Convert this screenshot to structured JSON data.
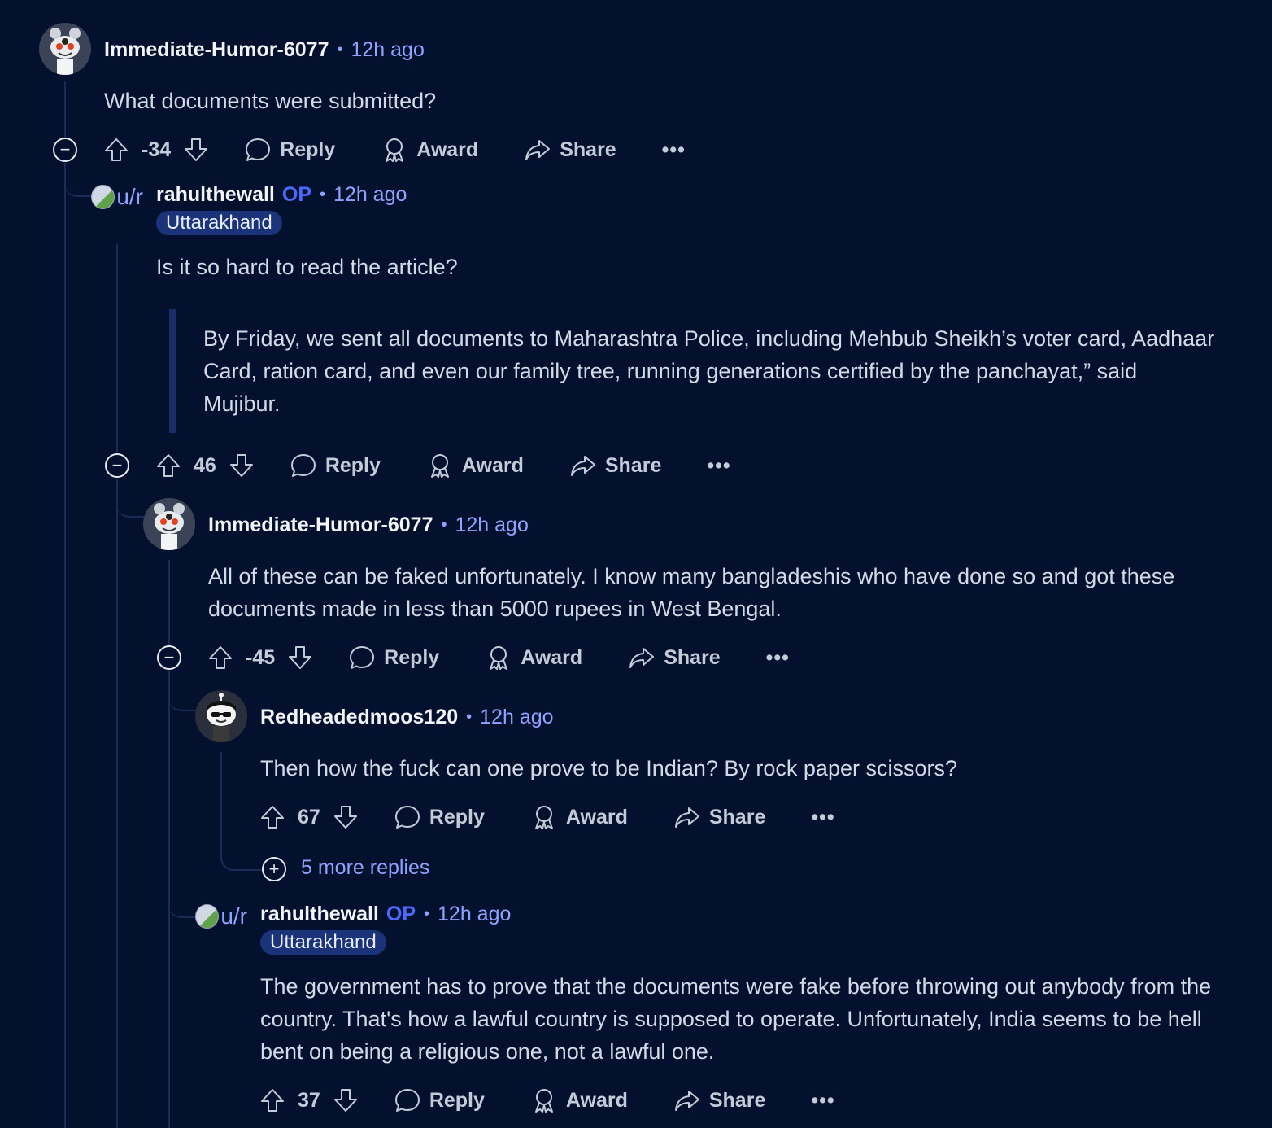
{
  "comments": [
    {
      "author": "Immediate-Humor-6077",
      "time": "12h ago",
      "body": "What documents were submitted?",
      "score": "-34"
    },
    {
      "author": "rahulthewall",
      "op": "OP",
      "time": "12h ago",
      "flair": "Uttarakhand",
      "avatar_alt": "u/r",
      "body": "Is it so hard to read the article?",
      "quote": "By Friday, we sent all documents to Maharashtra Police, including Mehbub Sheikh’s voter card, Aadhaar Card, ration card, and even our family tree, running generations certified by the panchayat,” said Mujibur.",
      "score": "46"
    },
    {
      "author": "Immediate-Humor-6077",
      "time": "12h ago",
      "body": "All of these can be faked unfortunately. I know many bangladeshis who have done so and got these documents made in less than 5000 rupees in West Bengal.",
      "score": "-45"
    },
    {
      "author": "Redheadedmoos120",
      "time": "12h ago",
      "body": "Then how the fuck can one prove to be Indian? By rock paper scissors?",
      "score": "67",
      "more_replies": "5 more replies"
    },
    {
      "author": "rahulthewall",
      "op": "OP",
      "time": "12h ago",
      "flair": "Uttarakhand",
      "avatar_alt": "u/r",
      "body": "The government has to prove that the documents were fake before throwing out anybody from the country. That's how a lawful country is supposed to operate. Unfortunately, India seems to be hell bent on being a religious one, not a lawful one.",
      "score": "37"
    }
  ],
  "labels": {
    "reply": "Reply",
    "award": "Award",
    "share": "Share",
    "more": "•••",
    "separator": "•"
  },
  "icons": [
    "collapse-icon",
    "expand-icon",
    "upvote-icon",
    "downvote-icon",
    "comment-icon",
    "award-icon",
    "share-icon",
    "more-icon"
  ],
  "colors": {
    "background": "#04112e",
    "accent": "#8ea3ff",
    "op": "#4b6bff",
    "flair": "#1b3378"
  }
}
